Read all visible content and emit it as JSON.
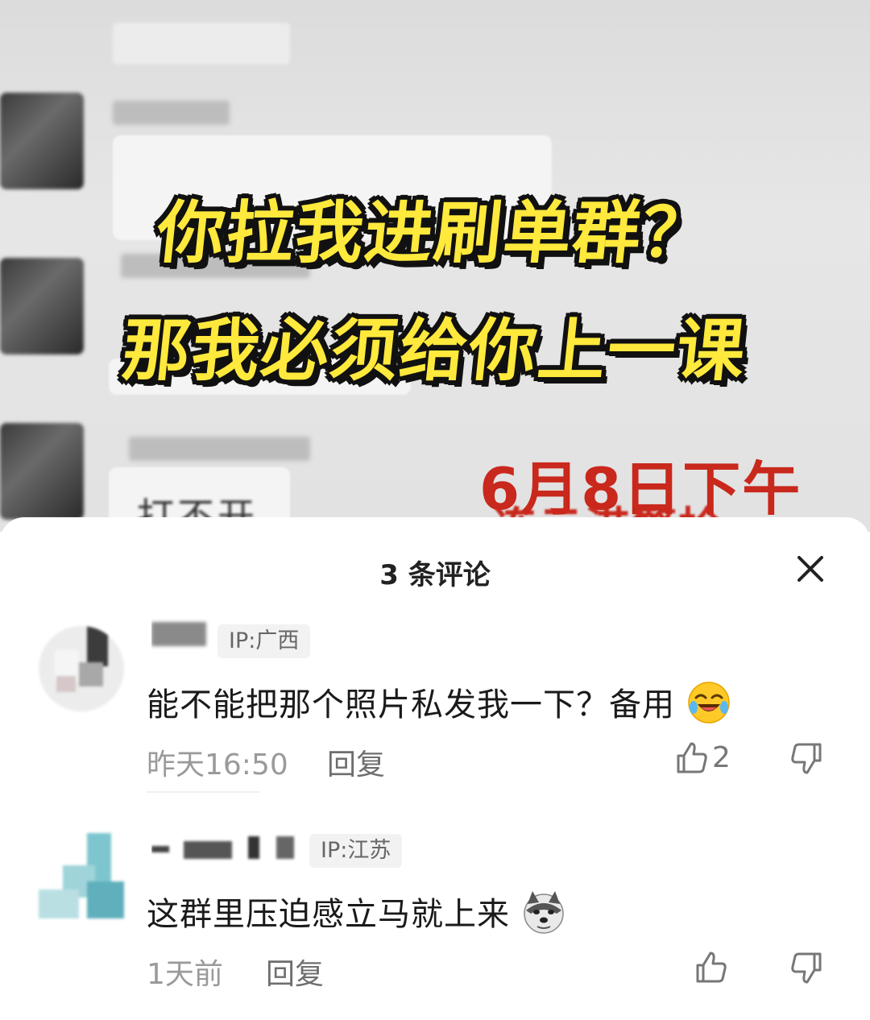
{
  "video": {
    "caption_line1": "你拉我进刷单群？",
    "caption_line2": "那我必须给你上一课",
    "date_text": "6月8日下午",
    "date_text_2": "连云港警检",
    "chat_snippet": "打不开"
  },
  "sheet": {
    "title": "3 条评论"
  },
  "comments": [
    {
      "ip": "IP:广西",
      "text": "能不能把那个照片私发我一下？备用",
      "emoji": "laughing-crying-emoji",
      "time": "昨天16:50",
      "reply_label": "回复",
      "likes": "2"
    },
    {
      "ip": "IP:江苏",
      "text": "这群里压迫感立马就上来",
      "emoji": "doge-emoji",
      "time": "1天前",
      "reply_label": "回复",
      "likes": ""
    }
  ],
  "colors": {
    "caption_fill": "#ffe93c",
    "caption_outline": "#111111",
    "date_red": "#c9281c",
    "muted_text": "#9a9a9a"
  }
}
